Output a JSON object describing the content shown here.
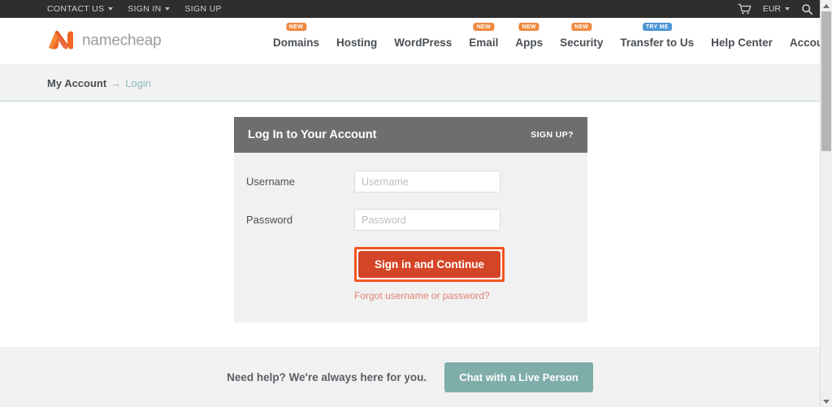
{
  "topbar": {
    "links": [
      {
        "label": "CONTACT US",
        "caret": true
      },
      {
        "label": "SIGN IN",
        "caret": true
      },
      {
        "label": "SIGN UP",
        "caret": false
      }
    ],
    "cart_icon": "cart-icon",
    "currency": "EUR",
    "search_icon": "search-icon"
  },
  "brand": {
    "name": "namecheap",
    "logo_icon": "namecheap-logo-icon",
    "logo_color": "#F26522"
  },
  "nav": {
    "items": [
      {
        "label": "Domains",
        "badge": "NEW",
        "badge_type": "new"
      },
      {
        "label": "Hosting",
        "badge": "",
        "badge_type": ""
      },
      {
        "label": "WordPress",
        "badge": "",
        "badge_type": ""
      },
      {
        "label": "Email",
        "badge": "NEW",
        "badge_type": "new"
      },
      {
        "label": "Apps",
        "badge": "NEW",
        "badge_type": "new"
      },
      {
        "label": "Security",
        "badge": "NEW",
        "badge_type": "new"
      },
      {
        "label": "Transfer to Us",
        "badge": "TRY ME",
        "badge_type": "try"
      },
      {
        "label": "Help Center",
        "badge": "",
        "badge_type": ""
      },
      {
        "label": "Account",
        "badge": "",
        "badge_type": ""
      }
    ],
    "badge_new_color": "#F0893F",
    "badge_try_color": "#4A95D6"
  },
  "breadcrumb": {
    "root": "My Account",
    "separator": "→",
    "current": "Login"
  },
  "login_card": {
    "title": "Log In to Your Account",
    "signup_label": "SIGN UP?",
    "username": {
      "label": "Username",
      "placeholder": "Username",
      "value": ""
    },
    "password": {
      "label": "Password",
      "placeholder": "Password",
      "value": ""
    },
    "submit_label": "Sign in and Continue",
    "forgot_label": "Forgot username or password?",
    "submit_color": "#D44427",
    "highlight_color": "#F4551D",
    "header_color": "#6E6E6E"
  },
  "footer": {
    "help_text": "Need help? We're always here for you.",
    "chat_label": "Chat with a Live Person",
    "chat_color": "#7FADA9"
  }
}
